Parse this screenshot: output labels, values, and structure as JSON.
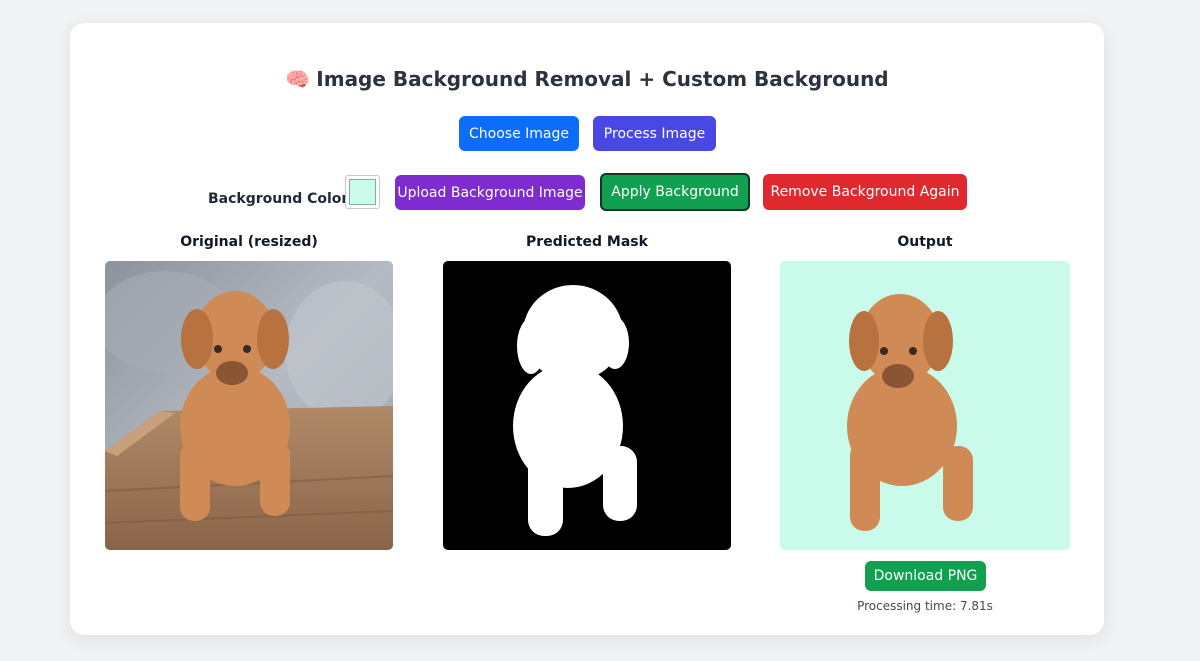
{
  "title": {
    "emoji": "🧠",
    "text": "Image Background Removal + Custom Background"
  },
  "buttons": {
    "choose_image": "Choose Image",
    "process_image": "Process Image",
    "upload_background": "Upload Background Image",
    "apply_background": "Apply Background",
    "remove_background_again": "Remove Background Again",
    "download_png": "Download PNG"
  },
  "background": {
    "label": "Background Color:",
    "color": "#c9faea"
  },
  "panels": {
    "original": "Original (resized)",
    "mask": "Predicted Mask",
    "output": "Output"
  },
  "status": {
    "processing_time": "Processing time: 7.81s"
  },
  "colors": {
    "choose": "#0b6dfa",
    "process": "#4a48e4",
    "upload": "#7e2bcf",
    "apply": "#11a050",
    "remove": "#e0282f",
    "download": "#11a050"
  }
}
